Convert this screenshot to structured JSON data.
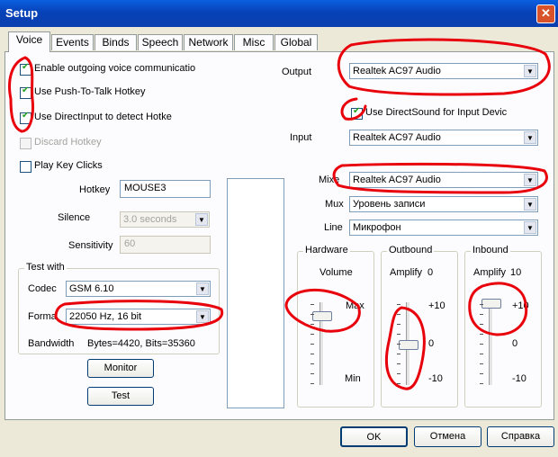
{
  "window": {
    "title": "Setup"
  },
  "tabs": [
    "Voice",
    "Events",
    "Binds",
    "Speech",
    "Network",
    "Misc",
    "Global"
  ],
  "voice": {
    "enable_outgoing": "Enable outgoing voice communicatio",
    "use_ptt": "Use Push-To-Talk Hotkey",
    "use_directinput": "Use DirectInput to detect Hotke",
    "discard_hotkey": "Discard Hotkey",
    "play_key_clicks": "Play Key Clicks",
    "hotkey_label": "Hotkey",
    "hotkey_value": "MOUSE3",
    "silence_label": "Silence",
    "silence_value": "3.0 seconds",
    "sensitivity_label": "Sensitivity",
    "sensitivity_value": "60",
    "test_with": "Test with",
    "codec_label": "Codec",
    "codec_value": "GSM 6.10",
    "format_label": "Forma",
    "format_value": "22050 Hz, 16 bit",
    "bandwidth_label": "Bandwidth",
    "bandwidth_value": "Bytes=4420, Bits=35360",
    "monitor_button": "Monitor",
    "test_button": "Test"
  },
  "audio": {
    "output_label": "Output",
    "output_value": "Realtek AC97 Audio",
    "directsound_label": "Use DirectSound for Input Devic",
    "input_label": "Input",
    "input_value": "Realtek AC97 Audio",
    "mixer_label": "Mixe",
    "mixer_value": "Realtek AC97 Audio",
    "mux_label": "Mux",
    "mux_value": "Уровень записи",
    "line_label": "Line",
    "line_value": "Микрофон"
  },
  "hardware": {
    "title": "Hardware",
    "volume_label": "Volume",
    "max_label": "Max",
    "min_label": "Min"
  },
  "outbound": {
    "title": "Outbound",
    "amplify_label": "Amplify",
    "amplify_value": "0",
    "plus10": "+10",
    "zero": "0",
    "minus10": "-10"
  },
  "inbound": {
    "title": "Inbound",
    "amplify_label": "Amplify",
    "amplify_value": "10",
    "plus10": "+10",
    "zero": "0",
    "minus10": "-10"
  },
  "sliders": {
    "hardware_volume_fraction": 0.85,
    "outbound_amplify": 0,
    "inbound_amplify": 10
  },
  "footer": {
    "ok": "OK",
    "cancel": "Отмена",
    "help": "Справка"
  },
  "annotation_color": "#e8000b"
}
